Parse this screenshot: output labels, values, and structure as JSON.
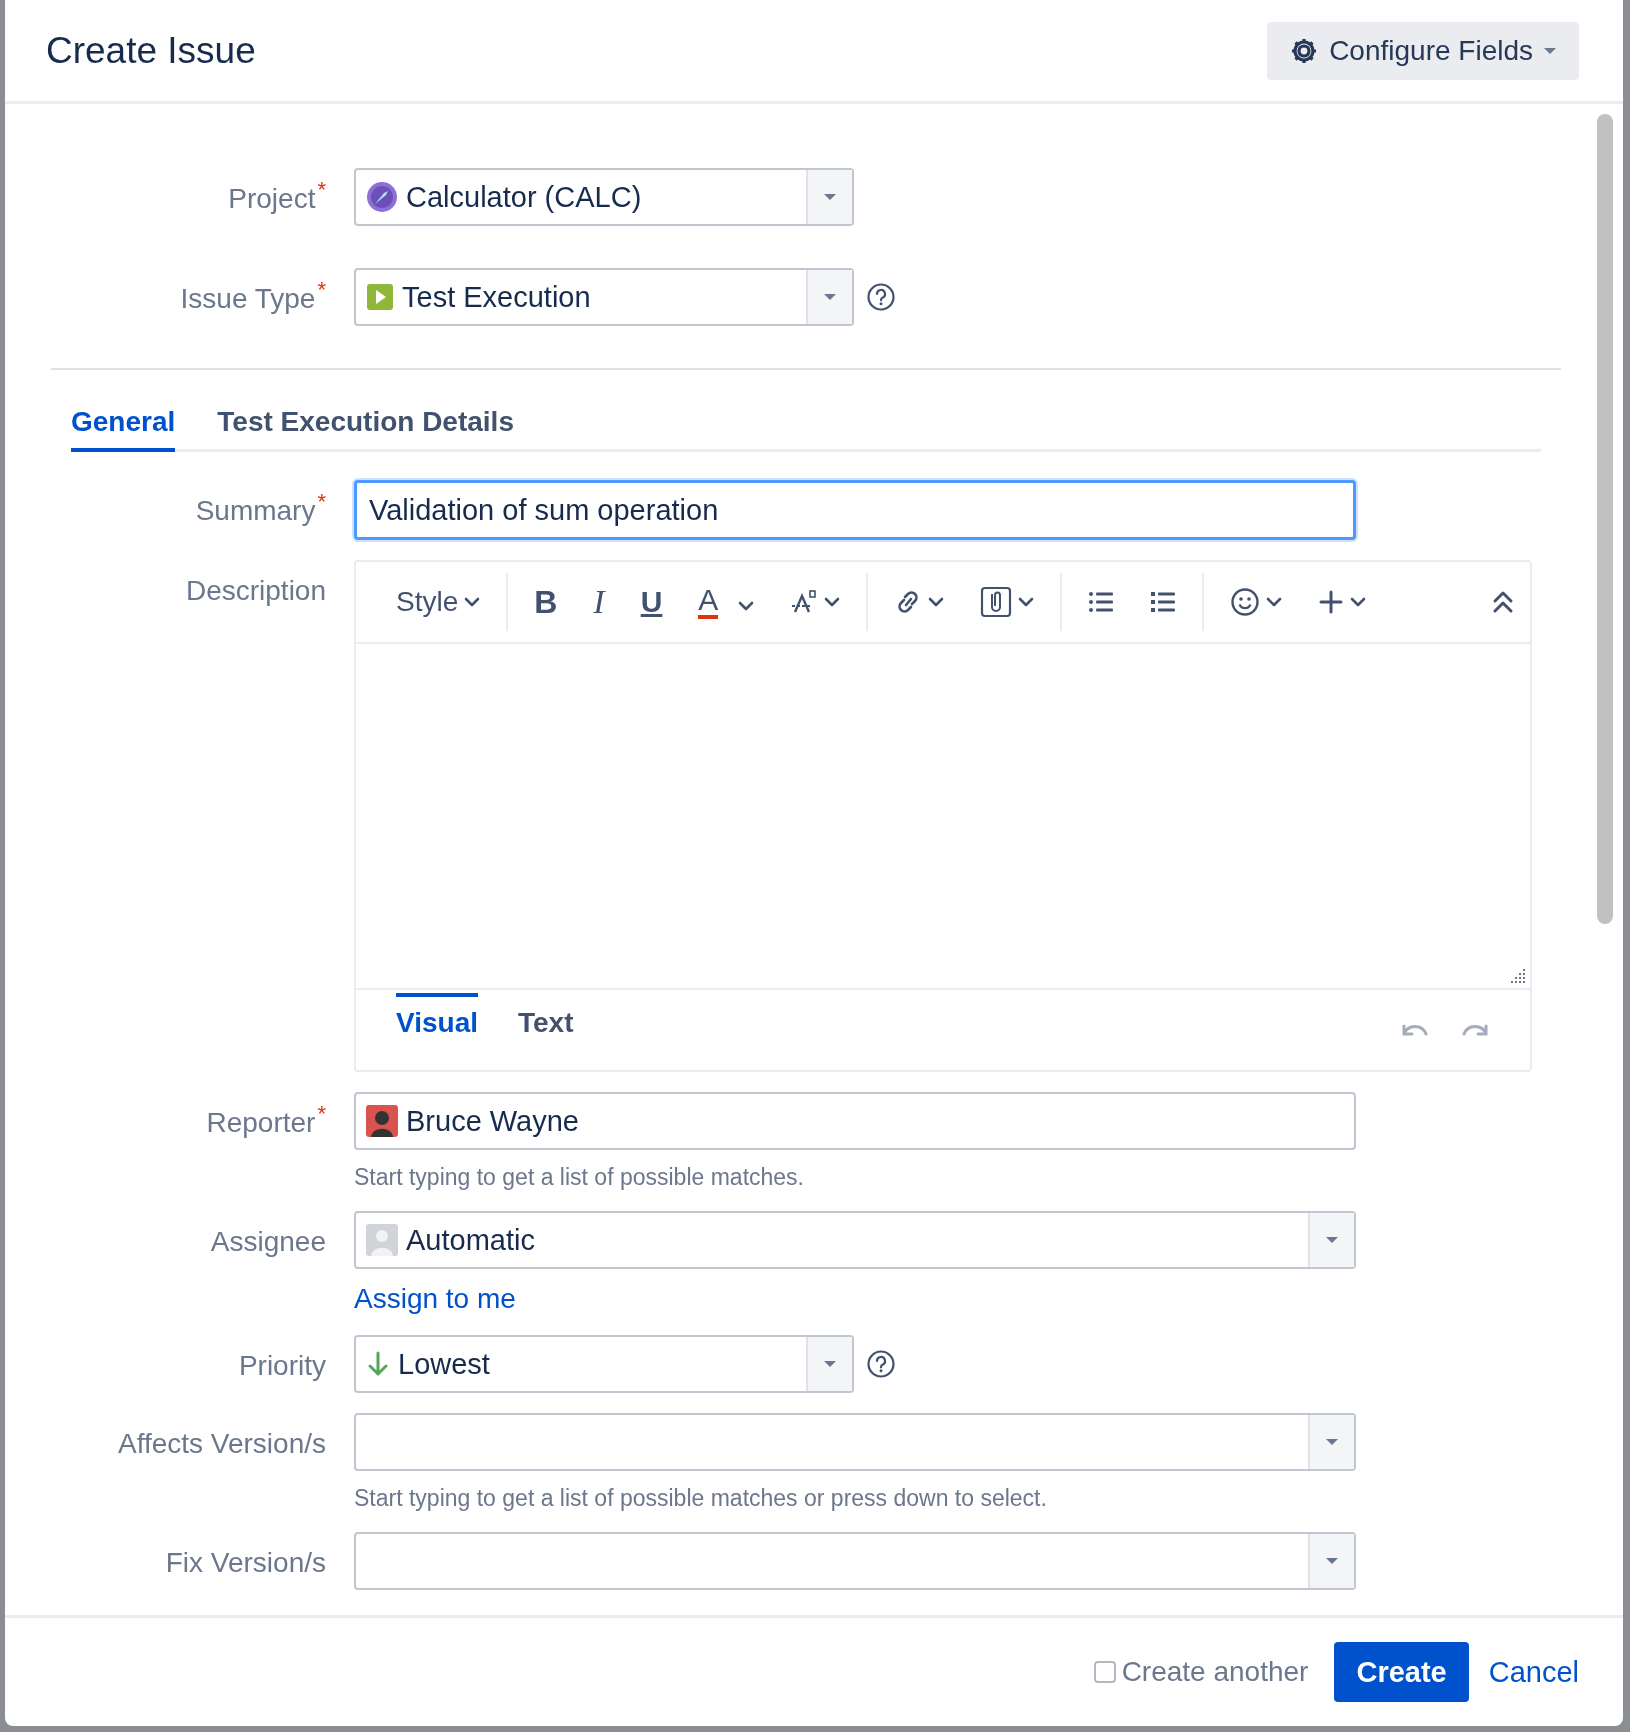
{
  "title": "Create Issue",
  "configure_button": {
    "label": "Configure Fields"
  },
  "top_fields": [
    {
      "label": "Project",
      "required_mark": "*",
      "value": "Calculator (CALC)",
      "help": false
    },
    {
      "label": "Issue Type",
      "required_mark": "*",
      "value": "Test Execution",
      "help": true
    }
  ],
  "tabs": [
    {
      "label": "General",
      "selected": true
    },
    {
      "label": "Test Execution Details",
      "selected": false
    }
  ],
  "fields": [
    {
      "kind": "text",
      "label": "Summary",
      "required_mark": "*",
      "value": "Validation of sum operation",
      "focused": true
    },
    {
      "kind": "editor",
      "label": "Description",
      "toolbar": [
        {
          "kind": "style",
          "label": "Style",
          "dropdown": true
        },
        {
          "kind": "sep"
        },
        {
          "kind": "bold",
          "label": "B",
          "dropdown": false
        },
        {
          "kind": "italic",
          "label": "I",
          "dropdown": false
        },
        {
          "kind": "underline",
          "label": "U",
          "dropdown": false
        },
        {
          "kind": "color",
          "label": "A",
          "dropdown": true
        },
        {
          "kind": "format",
          "dropdown": true
        },
        {
          "kind": "sep"
        },
        {
          "kind": "link",
          "dropdown": true
        },
        {
          "kind": "attach",
          "dropdown": true
        },
        {
          "kind": "sep"
        },
        {
          "kind": "bullets",
          "dropdown": false
        },
        {
          "kind": "numbers",
          "dropdown": false
        },
        {
          "kind": "sep"
        },
        {
          "kind": "emoji",
          "dropdown": true
        },
        {
          "kind": "insert",
          "dropdown": true
        }
      ],
      "modes": [
        {
          "label": "Visual",
          "selected": true
        },
        {
          "label": "Text",
          "selected": false
        }
      ]
    },
    {
      "kind": "user",
      "label": "Reporter",
      "required_mark": "*",
      "value": "Bruce Wayne",
      "hint": "Start typing to get a list of possible matches."
    },
    {
      "kind": "assignee",
      "label": "Assignee",
      "value": "Automatic",
      "link": "Assign to me"
    },
    {
      "kind": "priority",
      "label": "Priority",
      "value": "Lowest"
    },
    {
      "kind": "select",
      "label": "Affects Version/s",
      "hint": "Start typing to get a list of possible matches or press down to select."
    },
    {
      "kind": "select",
      "label": "Fix Version/s"
    }
  ],
  "footer": {
    "create_another": {
      "label": "Create another",
      "checked": false
    },
    "buttons": [
      {
        "label": "Create",
        "kind": "primary"
      },
      {
        "label": "Cancel",
        "kind": "link"
      }
    ]
  }
}
